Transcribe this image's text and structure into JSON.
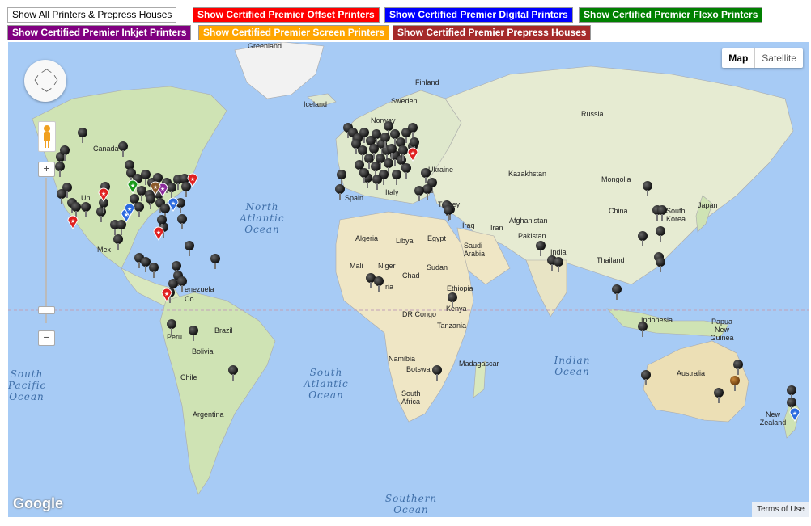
{
  "filters": [
    {
      "label": "Show All Printers & Prepress Houses",
      "color": "#ffffff"
    },
    {
      "label": "Show Certified Premier Offset Printers",
      "color": "#ff0000"
    },
    {
      "label": "Show Certified Premier Digital Printers",
      "color": "#0000ff"
    },
    {
      "label": "Show Certified Premier Flexo Printers",
      "color": "#008000"
    },
    {
      "label": "Show Certified Premier Inkjet Printers",
      "color": "#800080"
    },
    {
      "label": "Show Certified Premier Screen Printers",
      "color": "#ffa500"
    },
    {
      "label": "Show Certified Premier Prepress Houses",
      "color": "#a52a2a"
    }
  ],
  "map_type": {
    "map": "Map",
    "satellite": "Satellite",
    "selected": "Map"
  },
  "zoom": {
    "in": "+",
    "out": "−"
  },
  "labels": {
    "greenland": "Greenland",
    "iceland": "Iceland",
    "finland": "Finland",
    "sweden": "Sweden",
    "norway": "Norway",
    "russia": "Russia",
    "canada": "Canada",
    "ukraine": "Ukraine",
    "kazakhstan": "Kazakhstan",
    "mongolia": "Mongolia",
    "spain": "Spain",
    "italy": "Italy",
    "turkey": "Turkey",
    "china": "China",
    "south_korea": "South Korea",
    "japan": "Japan",
    "afghanistan": "Afghanistan",
    "iraq": "Iraq",
    "iran": "Iran",
    "pakistan": "Pakistan",
    "algeria": "Algeria",
    "libya": "Libya",
    "egypt": "Egypt",
    "saudi_arabia": "Saudi Arabia",
    "india": "India",
    "thailand": "Thailand",
    "mali": "Mali",
    "niger": "Niger",
    "chad": "Chad",
    "sudan": "Sudan",
    "ethiopia": "Ethiopia",
    "nigeria": "ria",
    "kenya": "Kenya",
    "dr_congo": "DR Congo",
    "tanzania": "Tanzania",
    "namibia": "Namibia",
    "botswana": "Botswana",
    "madagascar": "Madagascar",
    "south_africa": "South Africa",
    "mexico": "Mex",
    "venezuela": "enezuela",
    "colombia": "Co",
    "peru": "Peru",
    "brazil": "Brazil",
    "bolivia": "Bolivia",
    "chile": "Chile",
    "argentina": "Argentina",
    "indonesia": "Indonesia",
    "papua_new_guinea": "Papua New Guinea",
    "australia": "Australia",
    "new_zealand": "New Zealand",
    "united_states": "Uni"
  },
  "oceans": {
    "north_atlantic": "North Atlantic Ocean",
    "south_atlantic": "South Atlantic Ocean",
    "indian": "Indian Ocean",
    "south_pacific": "South Pacific Ocean",
    "southern": "Southern Ocean"
  },
  "attribution": {
    "logo": "Google",
    "terms": "Terms of Use"
  },
  "marker_colors": {
    "standard": "#111111",
    "offset": "#e02020",
    "digital": "#2b6be0",
    "flexo": "#1a9a1a",
    "inkjet": "#8a2a9a",
    "screen": "#f0a020",
    "prepress": "#8b5a2b"
  }
}
